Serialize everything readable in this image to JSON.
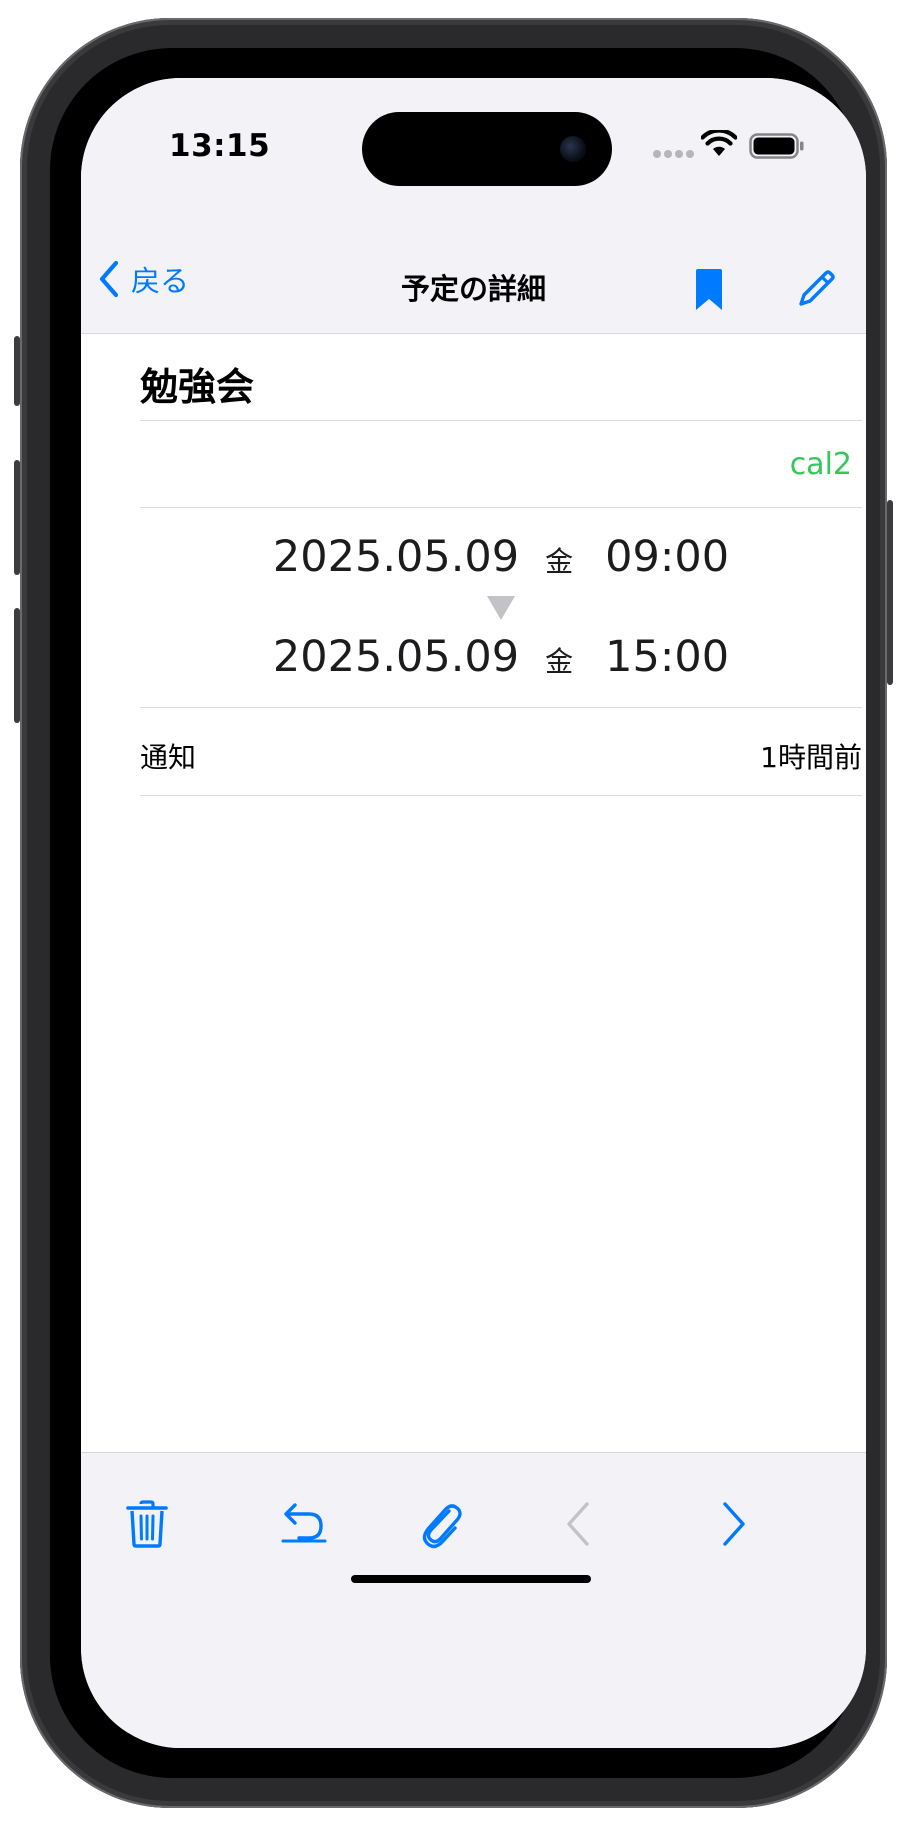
{
  "status": {
    "time": "13:15"
  },
  "nav": {
    "back_label": "戻る",
    "title": "予定の詳細",
    "icons": [
      "chevron-left-icon",
      "bookmark-icon",
      "pencil-icon"
    ]
  },
  "event": {
    "title": "勉強会",
    "calendar": "cal2",
    "start": {
      "date": "2025.05.09",
      "weekday": "金",
      "time": "09:00"
    },
    "end": {
      "date": "2025.05.09",
      "weekday": "金",
      "time": "15:00"
    },
    "notification": {
      "label": "通知",
      "value": "1時間前"
    }
  },
  "toolbar": {
    "icons": [
      "trash-icon",
      "undo-icon",
      "paperclip-icon",
      "chevron-left-icon",
      "chevron-right-icon"
    ]
  },
  "colors": {
    "accent": "#007aff",
    "calendar": "#34c759",
    "disabled": "#c2c2c7",
    "bar_background": "#f2f2f7"
  }
}
